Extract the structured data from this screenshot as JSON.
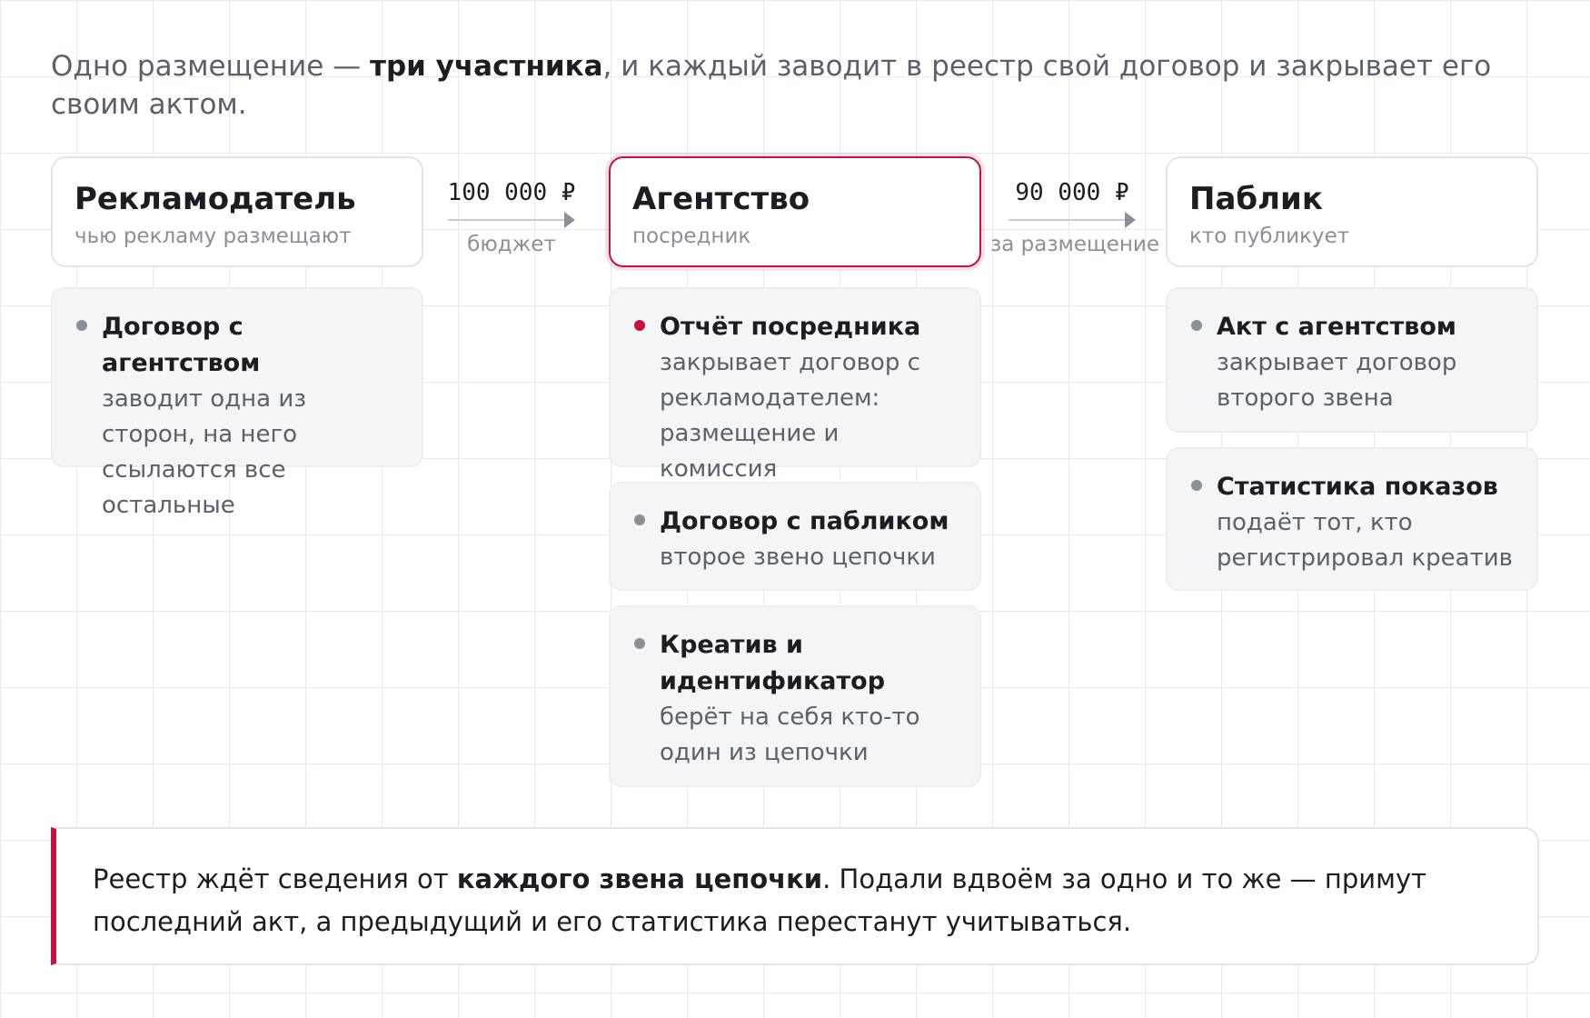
{
  "intro": {
    "text_before": "Одно размещение — ",
    "bold": "три участника",
    "text_after": ", и каждый заводит в реестр свой договор и закрывает его своим актом."
  },
  "participants": [
    {
      "title": "Рекламодатель",
      "subtitle": "чью рекламу размещают"
    },
    {
      "title": "Агентство",
      "subtitle": "посредник"
    },
    {
      "title": "Паблик",
      "subtitle": "кто публикует"
    }
  ],
  "flows": [
    {
      "amount": "100 000 ₽",
      "label": "бюджет"
    },
    {
      "amount": "90 000 ₽",
      "label": "за размещение"
    }
  ],
  "documents": {
    "advertiser": [
      {
        "title": "Договор с агентством",
        "desc": "заводит одна из сторон, на него ссылаются все остальные"
      }
    ],
    "agency": [
      {
        "title": "Отчёт посредника",
        "desc": "закрывает договор с рекламодателем: размещение и комиссия"
      },
      {
        "title": "Договор с пабликом",
        "desc": "второе звено цепочки"
      },
      {
        "title": "Креатив и идентификатор",
        "desc": "берёт на себя кто-то один из цепочки"
      }
    ],
    "public": [
      {
        "title": "Акт с агентством",
        "desc": "закрывает договор второго звена"
      },
      {
        "title": "Статистика показов",
        "desc": "подаёт тот, кто регистрировал креатив"
      }
    ]
  },
  "note": {
    "text_before": "Реестр ждёт сведения от ",
    "bold": "каждого звена цепочки",
    "text_after": ". Подали вдвоём за одно и то же — примут последний акт, а предыдущий и его статистика перестанут учитываться."
  },
  "colors": {
    "accent": "#c4143c",
    "bullet": "#8a8f99",
    "muted_text": "#5b616c"
  }
}
